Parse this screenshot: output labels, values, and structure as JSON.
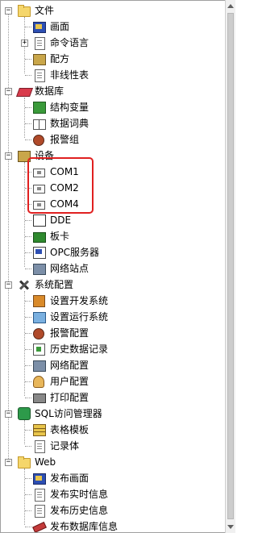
{
  "tree": {
    "file": {
      "label": "文件",
      "children": [
        "画面",
        "命令语言",
        "配方",
        "非线性表"
      ]
    },
    "database": {
      "label": "数据库",
      "children": [
        "结构变量",
        "数据词典",
        "报警组"
      ]
    },
    "devices": {
      "label": "设备",
      "children": [
        "COM1",
        "COM2",
        "COM4",
        "DDE",
        "板卡",
        "OPC服务器",
        "网络站点"
      ]
    },
    "sysconfig": {
      "label": "系统配置",
      "children": [
        "设置开发系统",
        "设置运行系统",
        "报警配置",
        "历史数据记录",
        "网络配置",
        "用户配置",
        "打印配置"
      ]
    },
    "sql": {
      "label": "SQL访问管理器",
      "children": [
        "表格模板",
        "记录体"
      ]
    },
    "web": {
      "label": "Web",
      "children": [
        "发布画面",
        "发布实时信息",
        "发布历史信息",
        "发布数据库信息"
      ]
    }
  },
  "colors": {
    "highlight_border": "#e02020",
    "tree_line": "#9a9a9a"
  }
}
